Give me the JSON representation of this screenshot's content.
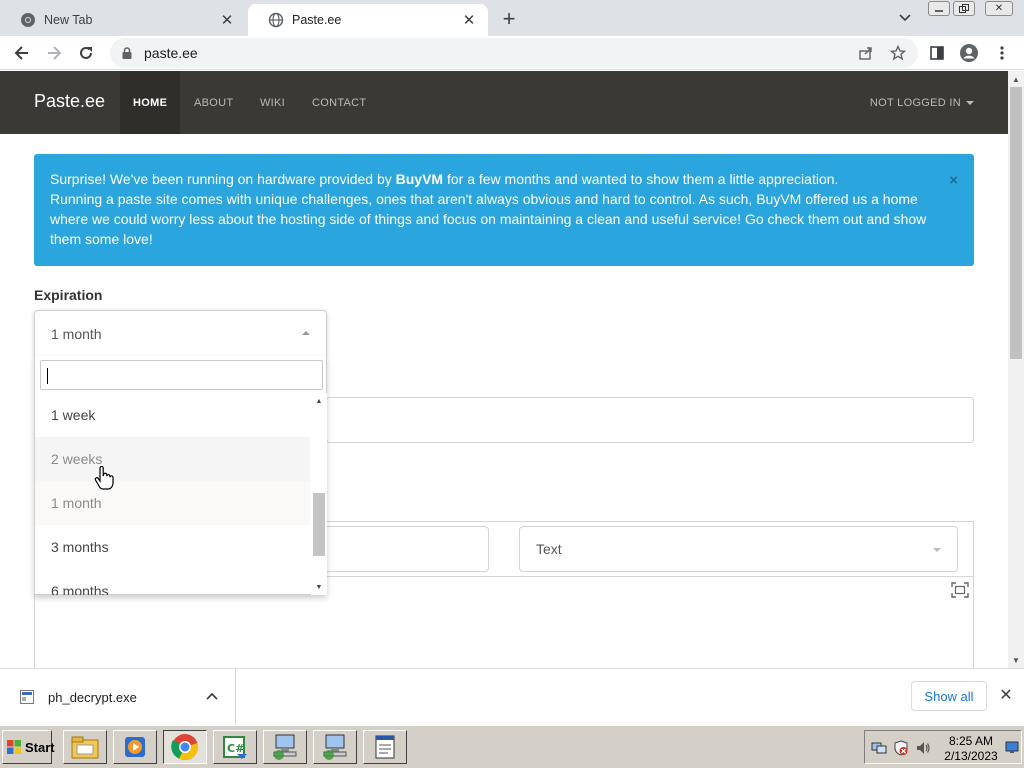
{
  "browser": {
    "tabs": [
      {
        "title": "New Tab",
        "active": false
      },
      {
        "title": "Paste.ee",
        "active": true
      }
    ],
    "url": "paste.ee"
  },
  "site": {
    "brand": "Paste.ee",
    "nav": [
      "HOME",
      "ABOUT",
      "WIKI",
      "CONTACT"
    ],
    "login": "NOT LOGGED IN",
    "alert": {
      "pre": "Surprise! We've been running on hardware provided by ",
      "brand": "BuyVM",
      "post": " for a few months and wanted to show them a little appreciation.",
      "body": "Running a paste site comes with unique challenges, ones that aren't always obvious and hard to control. As such, BuyVM offered us a home where we could worry less about the hosting side of things and focus on maintaining a clean and useful service! Go check them out and show them some love!",
      "close": "×"
    },
    "expiration_label": "Expiration",
    "expiration_selected": "1 month",
    "expiration_options": [
      "1 week",
      "2 weeks",
      "1 month",
      "3 months",
      "6 months"
    ],
    "syntax_selected": "Text"
  },
  "downloads": {
    "file": "ph_decrypt.exe",
    "show_all": "Show all"
  },
  "taskbar": {
    "start": "Start",
    "time": "8:25 AM",
    "date": "2/13/2023"
  },
  "colors": {
    "navbar": "#3a3936",
    "alert": "#2ba5de",
    "link_blue": "#1a73e8"
  }
}
